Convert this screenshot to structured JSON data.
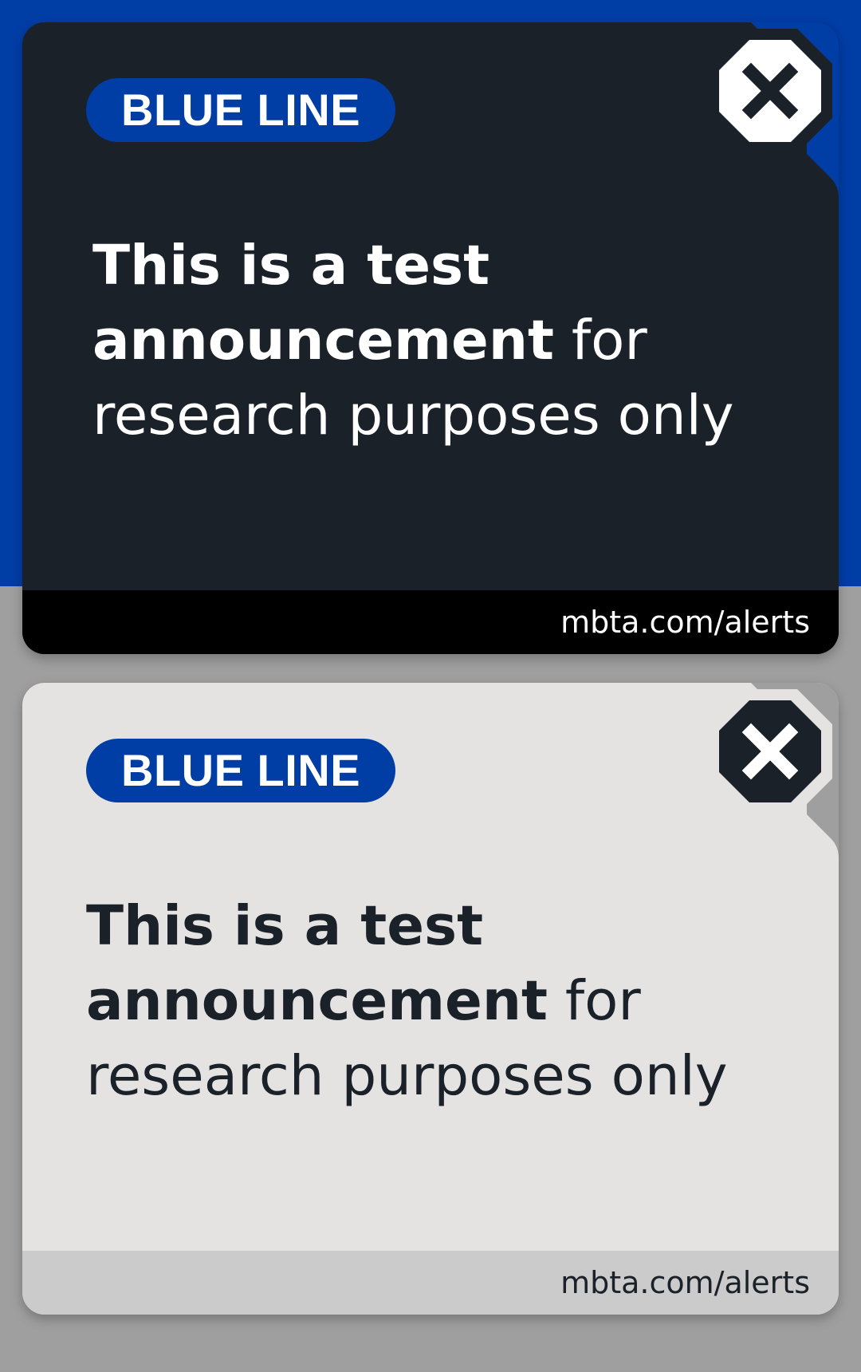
{
  "colors": {
    "brand_blue": "#003da5",
    "dark_card": "#1b2129",
    "light_card": "#e4e3e1",
    "page_gray": "#9f9f9f"
  },
  "alerts": [
    {
      "theme": "dark",
      "line_badge": "BLUE LINE",
      "message_bold": "This is a test announcement",
      "message_rest": " for research purposes only",
      "footer_link": "mbta.com/alerts",
      "close_icon": "close-x-octagon-icon"
    },
    {
      "theme": "light",
      "line_badge": "BLUE LINE",
      "message_bold": "This is a test announcement",
      "message_rest": " for research purposes only",
      "footer_link": "mbta.com/alerts",
      "close_icon": "close-x-octagon-icon"
    }
  ]
}
